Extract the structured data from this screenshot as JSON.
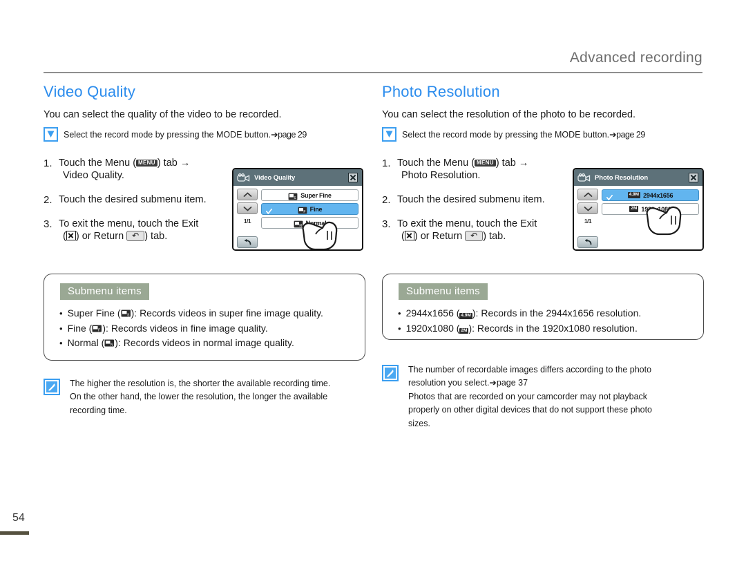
{
  "header": {
    "chapter_title": "Advanced recording"
  },
  "page_number": "54",
  "columns": [
    {
      "title": "Video Quality",
      "intro": "You can select the quality of the video to be recorded.",
      "check_note": "Select the record mode by pressing the MODE button.",
      "check_note_ref": "➔page 29",
      "steps": [
        {
          "num": "1.",
          "text_before": "Touch the Menu (",
          "chip": "MENU",
          "text_after": ") tab →",
          "subtext": "Video Quality."
        },
        {
          "num": "2.",
          "text_before": "Touch the desired submenu item.",
          "chip": "",
          "text_after": "",
          "subtext": ""
        },
        {
          "num": "3.",
          "text_before": "To exit the menu, touch the Exit",
          "chip": "",
          "text_after": "",
          "subtext": ") or Return ( ) tab."
        }
      ],
      "lcd": {
        "title": "Video Quality",
        "page_indicator": "1/1",
        "rows": [
          {
            "label": "Super Fine",
            "badge": "",
            "selected": false
          },
          {
            "label": "Fine",
            "badge": "",
            "selected": true
          },
          {
            "label": "Normal",
            "badge": "",
            "selected": false
          }
        ]
      },
      "submenu": {
        "header": "Submenu items",
        "items": [
          "Super Fine ( ): Records videos in super fine image quality.",
          "Fine ( ): Records videos in fine image quality.",
          "Normal ( ): Records videos in normal image quality."
        ],
        "items_parts": [
          {
            "name": "Super Fine",
            "desc": "Records videos in super fine image quality."
          },
          {
            "name": "Fine",
            "desc": "Records videos in fine image quality."
          },
          {
            "name": "Normal",
            "desc": "Records videos in normal image quality."
          }
        ]
      },
      "note": [
        "The higher the resolution is, the shorter the available recording time.",
        "On the other hand, the lower the resolution, the longer the available",
        "recording time."
      ]
    },
    {
      "title": "Photo Resolution",
      "intro": "You can select the resolution of the photo to be recorded.",
      "check_note": "Select the record mode by pressing the MODE button.",
      "check_note_ref": "➔page 29",
      "steps": [
        {
          "num": "1.",
          "text_before": "Touch the Menu (",
          "chip": "MENU",
          "text_after": ") tab →",
          "subtext": "Photo Resolution."
        },
        {
          "num": "2.",
          "text_before": "Touch the desired submenu item.",
          "chip": "",
          "text_after": "",
          "subtext": ""
        },
        {
          "num": "3.",
          "text_before": "To exit the menu, touch the Exit",
          "chip": "",
          "text_after": "",
          "subtext": ") or Return ( ) tab."
        }
      ],
      "lcd": {
        "title": "Photo Resolution",
        "page_indicator": "1/1",
        "rows": [
          {
            "label": "2944x1656",
            "badge": "4.9M",
            "selected": true
          },
          {
            "label": "1920x1080",
            "badge": "2M",
            "selected": false
          }
        ]
      },
      "submenu": {
        "header": "Submenu items",
        "items_parts": [
          {
            "name": "2944x1656",
            "badge": "4.9M",
            "desc": "Records in the 2944x1656 resolution."
          },
          {
            "name": "1920x1080",
            "badge": "2M",
            "desc": "Records in the 1920x1080 resolution."
          }
        ]
      },
      "note": [
        "The number of recordable images differs according to the photo",
        "resolution you select.➔page 37",
        "Photos that are recorded on your camcorder may not playback",
        "properly on other digital devices that do not support these photo",
        "sizes."
      ]
    }
  ],
  "step3_text": {
    "line1": "To exit the menu, touch the Exit",
    "line2_a": "(",
    "line2_b": ") or Return ",
    "line2_c": ") tab."
  },
  "colors": {
    "section_title": "#2b8ced",
    "chapter_title": "#6e6e6e",
    "submenu_header_bg": "#9aa894",
    "lcd_titlebar": "#5d7179",
    "lcd_selected_row": "#62b5ef",
    "note_icon_border": "#3b9ef0",
    "page_rule": "#55513f"
  },
  "icons": {
    "check": "check-icon",
    "camcorder": "camcorder-icon",
    "close": "close-icon",
    "return": "return-arrow-icon",
    "up": "chevron-up-icon",
    "down": "chevron-down-icon",
    "note": "note-pen-icon",
    "finger": "pointing-hand-icon",
    "quality": "video-quality-icon"
  }
}
